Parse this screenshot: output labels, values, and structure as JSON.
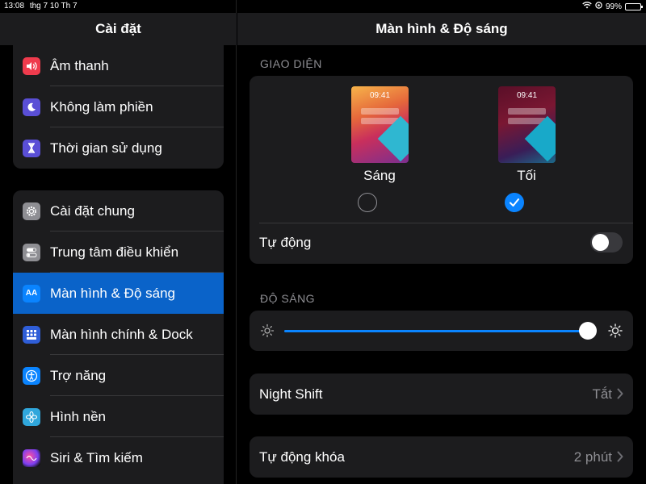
{
  "status": {
    "time": "13:08",
    "date": "thg 7 10 Th 7",
    "battery": "99%"
  },
  "sidebar": {
    "title": "Cài đặt",
    "group1": [
      {
        "label": "Âm thanh",
        "icon": "speaker-icon",
        "color": "#ef3b4d"
      },
      {
        "label": "Không làm phiền",
        "icon": "moon-icon",
        "color": "#5a4fd6"
      },
      {
        "label": "Thời gian sử dụng",
        "icon": "hourglass-icon",
        "color": "#5a4fd6"
      }
    ],
    "group2": [
      {
        "label": "Cài đặt chung",
        "icon": "gear-icon",
        "color": "#8e8e93"
      },
      {
        "label": "Trung tâm điều khiển",
        "icon": "switches-icon",
        "color": "#8e8e93"
      },
      {
        "label": "Màn hình & Độ sáng",
        "icon": "text-size-icon",
        "color": "#0a84ff",
        "icon_text": "AA"
      },
      {
        "label": "Màn hình chính & Dock",
        "icon": "grid-icon",
        "color": "#2f5ed8"
      },
      {
        "label": "Trợ năng",
        "icon": "accessibility-icon",
        "color": "#0a84ff"
      },
      {
        "label": "Hình nền",
        "icon": "flower-icon",
        "color": "#30a7dc"
      },
      {
        "label": "Siri & Tìm kiếm",
        "icon": "siri-icon",
        "color": "#222"
      }
    ]
  },
  "main": {
    "title": "Màn hình & Độ sáng",
    "appearance": {
      "section": "GIAO DIỆN",
      "light_label": "Sáng",
      "dark_label": "Tối",
      "preview_time": "09:41",
      "selected": "dark",
      "auto_label": "Tự động",
      "auto_on": false
    },
    "brightness": {
      "section": "ĐỘ SÁNG",
      "level": 0.99
    },
    "night_shift": {
      "label": "Night Shift",
      "value": "Tắt"
    },
    "auto_lock": {
      "label": "Tự động khóa",
      "value": "2 phút"
    }
  }
}
